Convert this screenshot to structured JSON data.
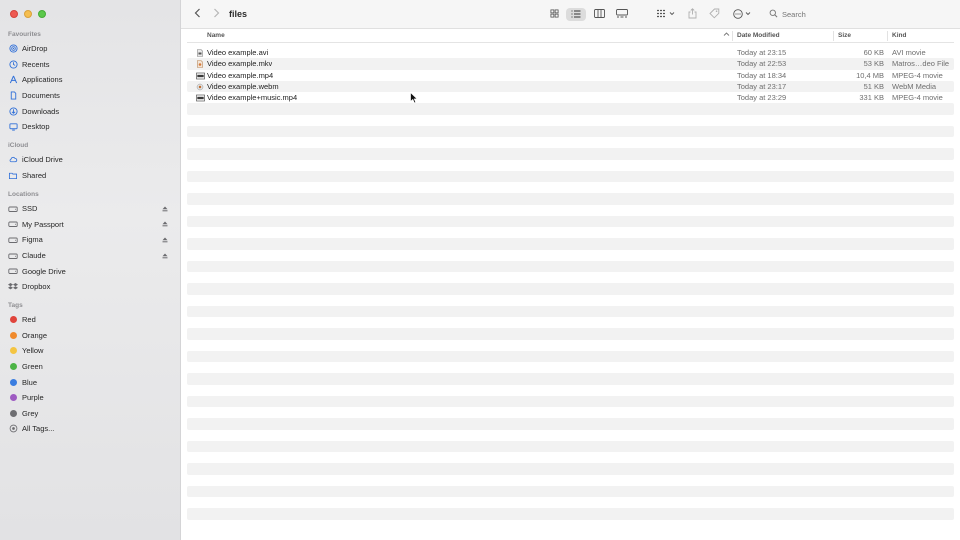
{
  "window": {
    "title": "files"
  },
  "sidebar": {
    "sections": [
      {
        "heading": "Favourites",
        "items": [
          {
            "label": "AirDrop",
            "icon": "airdrop-icon"
          },
          {
            "label": "Recents",
            "icon": "clock-icon"
          },
          {
            "label": "Applications",
            "icon": "applications-icon"
          },
          {
            "label": "Documents",
            "icon": "document-icon"
          },
          {
            "label": "Downloads",
            "icon": "download-icon"
          },
          {
            "label": "Desktop",
            "icon": "desktop-icon"
          }
        ]
      },
      {
        "heading": "iCloud",
        "items": [
          {
            "label": "iCloud Drive",
            "icon": "cloud-icon"
          },
          {
            "label": "Shared",
            "icon": "shared-folder-icon"
          }
        ]
      },
      {
        "heading": "Locations",
        "items": [
          {
            "label": "SSD",
            "icon": "drive-icon",
            "eject": true
          },
          {
            "label": "My Passport",
            "icon": "drive-icon",
            "eject": true
          },
          {
            "label": "Figma",
            "icon": "drive-icon",
            "eject": true
          },
          {
            "label": "Claude",
            "icon": "drive-icon",
            "eject": true
          },
          {
            "label": "Google Drive",
            "icon": "drive-icon"
          },
          {
            "label": "Dropbox",
            "icon": "dropbox-icon"
          }
        ]
      },
      {
        "heading": "Tags",
        "items": [
          {
            "label": "Red",
            "color": "#e0443c"
          },
          {
            "label": "Orange",
            "color": "#f08a2c"
          },
          {
            "label": "Yellow",
            "color": "#f4c542"
          },
          {
            "label": "Green",
            "color": "#4cb445"
          },
          {
            "label": "Blue",
            "color": "#3a7de0"
          },
          {
            "label": "Purple",
            "color": "#9e5bc2"
          },
          {
            "label": "Grey",
            "color": "#8e8e92"
          },
          {
            "label": "All Tags...",
            "icon": "all-tags-icon"
          }
        ]
      }
    ]
  },
  "toolbar": {
    "search_placeholder": "Search"
  },
  "columns": {
    "name": "Name",
    "date": "Date Modified",
    "size": "Size",
    "kind": "Kind"
  },
  "files": [
    {
      "name": "Video example.avi",
      "date": "Today at 23:15",
      "size": "60 KB",
      "kind": "AVI movie"
    },
    {
      "name": "Video example.mkv",
      "date": "Today at 22:53",
      "size": "53 KB",
      "kind": "Matros…deo File"
    },
    {
      "name": "Video example.mp4",
      "date": "Today at 18:34",
      "size": "10,4 MB",
      "kind": "MPEG-4 movie"
    },
    {
      "name": "Video example.webm",
      "date": "Today at 23:17",
      "size": "51 KB",
      "kind": "WebM Media"
    },
    {
      "name": "Video example+music.mp4",
      "date": "Today at 23:29",
      "size": "331 KB",
      "kind": "MPEG-4 movie"
    }
  ],
  "colors": {
    "accent": "#1f6fe0",
    "sidebar_icon": "#2f6fd8"
  }
}
